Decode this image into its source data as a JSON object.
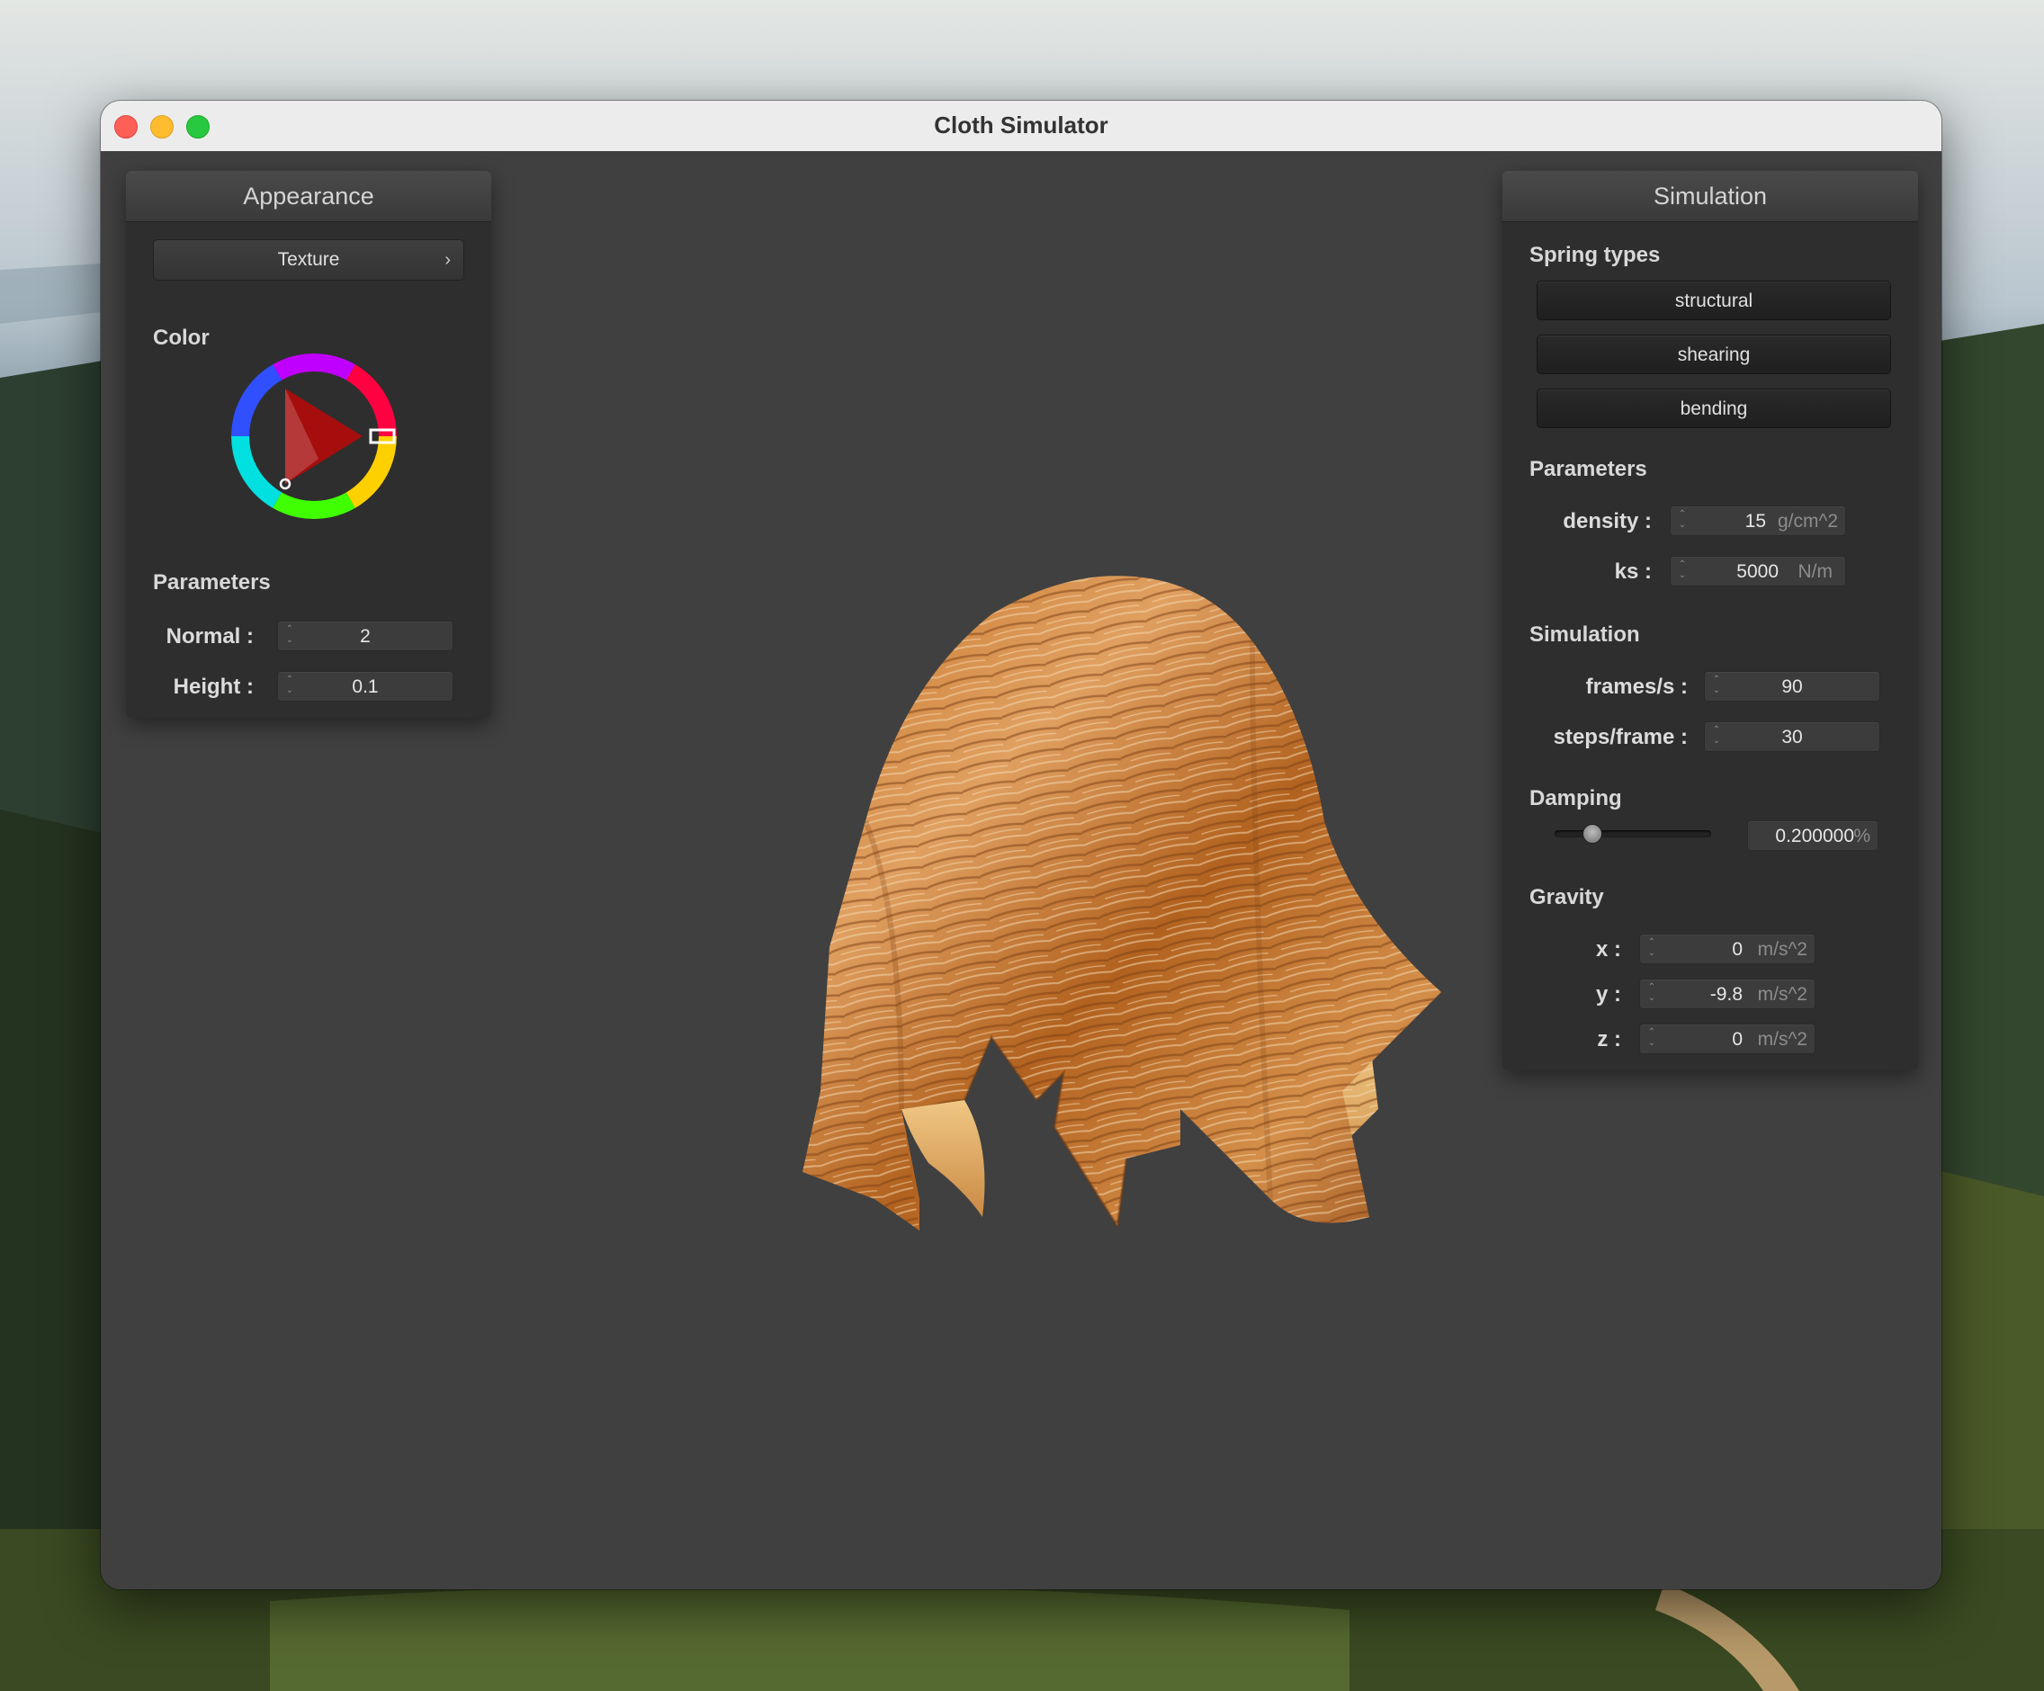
{
  "window": {
    "title": "Cloth Simulator"
  },
  "appearance": {
    "title": "Appearance",
    "texture_label": "Texture",
    "color_label": "Color",
    "parameters_label": "Parameters",
    "normal": {
      "label": "Normal :",
      "value": "2"
    },
    "height": {
      "label": "Height :",
      "value": "0.1"
    },
    "selected_color": "#ff0000"
  },
  "simulation_panel": {
    "title": "Simulation",
    "spring_types_label": "Spring types",
    "springs": [
      "structural",
      "shearing",
      "bending"
    ],
    "parameters_label": "Parameters",
    "density": {
      "label": "density :",
      "value": "15",
      "unit": "g/cm^2"
    },
    "ks": {
      "label": "ks :",
      "value": "5000",
      "unit": "N/m"
    },
    "simulation_label": "Simulation",
    "fps": {
      "label": "frames/s :",
      "value": "90"
    },
    "steps": {
      "label": "steps/frame :",
      "value": "30"
    },
    "damping_label": "Damping",
    "damping": {
      "value": "0.200000",
      "unit": "%",
      "level": 0.2
    },
    "gravity_label": "Gravity",
    "gx": {
      "label": "x :",
      "value": "0",
      "unit": "m/s^2"
    },
    "gy": {
      "label": "y :",
      "value": "-9.8",
      "unit": "m/s^2"
    },
    "gz": {
      "label": "z :",
      "value": "0",
      "unit": "m/s^2"
    }
  }
}
